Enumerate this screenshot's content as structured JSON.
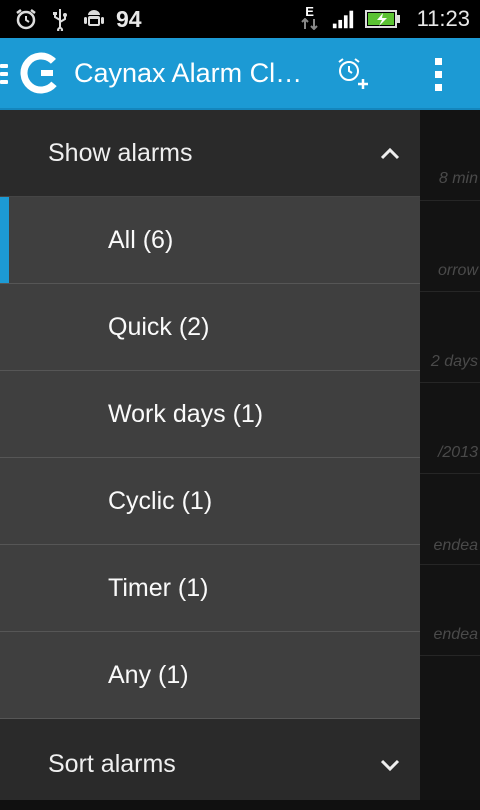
{
  "status_bar": {
    "icons": [
      "alarm-clock-icon",
      "usb-icon",
      "android-debug-icon",
      "network-e-icon",
      "signal-icon",
      "battery-charging-icon"
    ],
    "battery_level": "94",
    "network_type": "E",
    "time": "11:23",
    "battery_color": "#5bc232"
  },
  "action_bar": {
    "title": "Caynax Alarm Cl…",
    "logo": "caynax-logo",
    "add_alarm_icon": "alarm-add-icon",
    "menu_icon": "overflow-menu-icon",
    "color": "#1c9ad4"
  },
  "drawer": {
    "show_alarms": {
      "label": "Show alarms",
      "expanded": true,
      "icon": "chevron-up-icon",
      "items": [
        {
          "label": "All (6)",
          "selected": true
        },
        {
          "label": "Quick (2)",
          "selected": false
        },
        {
          "label": "Work days (1)",
          "selected": false
        },
        {
          "label": "Cyclic (1)",
          "selected": false
        },
        {
          "label": "Timer (1)",
          "selected": false
        },
        {
          "label": "Any (1)",
          "selected": false
        }
      ]
    },
    "sort_alarms": {
      "label": "Sort alarms",
      "expanded": false,
      "icon": "chevron-down-icon"
    }
  },
  "background_list": {
    "subtitles": [
      "8 min",
      "orrow",
      "2 days",
      "/2013",
      "endea",
      "endea"
    ]
  }
}
